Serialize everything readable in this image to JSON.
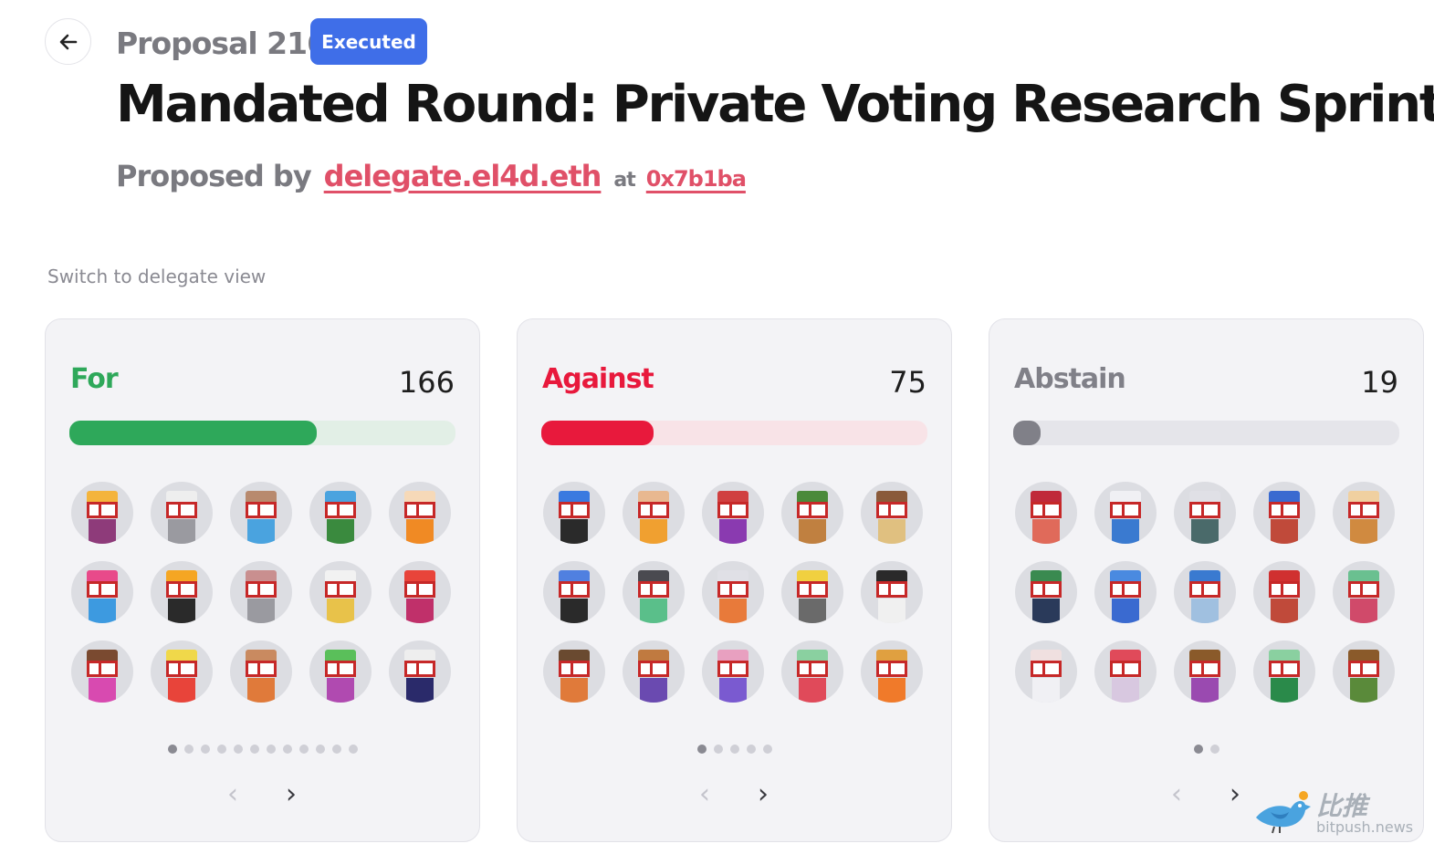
{
  "header": {
    "proposal_number": "Proposal 216",
    "status": "Executed",
    "title": "Mandated Round: Private Voting Research Sprint",
    "proposed_by_label": "Proposed by",
    "proposer": "delegate.el4d.eth",
    "at_label": "at",
    "tx": "0x7b1ba"
  },
  "switch_view_label": "Switch to delegate view",
  "colors": {
    "status_badge": "#3f6ee8",
    "link": "#e05068",
    "for": "#2ea85a",
    "against": "#e8193c",
    "abstain": "#808088"
  },
  "vote_cards": [
    {
      "label": "For",
      "count": "166",
      "progress_fraction": 0.64,
      "page_count": 12,
      "active_page": 1
    },
    {
      "label": "Against",
      "count": "75",
      "progress_fraction": 0.29,
      "page_count": 5,
      "active_page": 1
    },
    {
      "label": "Abstain",
      "count": "19",
      "progress_fraction": 0.07,
      "page_count": 2,
      "active_page": 1
    }
  ],
  "nav": {
    "prev_icon": "chevron-left-icon",
    "next_icon": "chevron-right-icon",
    "prev_glyph": "‹",
    "next_glyph": "›"
  },
  "watermark": {
    "cn": "比推",
    "en": "bitpush.news"
  }
}
